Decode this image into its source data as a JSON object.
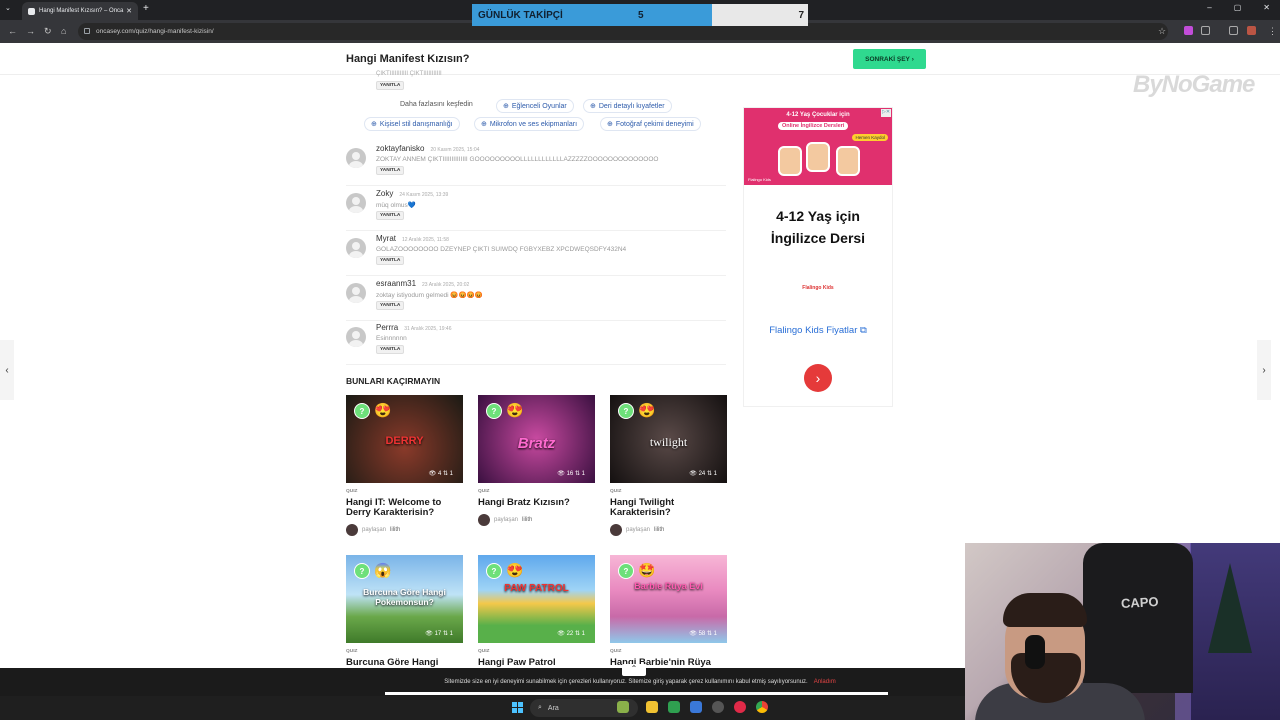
{
  "browser": {
    "tab_title": "Hangi Manifest Kızısın? – Onca",
    "url": "oncasey.com/quiz/hangi-manifest-kizisin/",
    "window_controls": [
      "–",
      "▢",
      "✕"
    ]
  },
  "overlay": {
    "label": "GÜNLÜK TAKİPÇİ",
    "current": "5",
    "goal": "7",
    "progress": 0.714
  },
  "site": {
    "page_title": "Hangi Manifest Kızısın?",
    "next_button": "SONRAKİ ŞEY",
    "watermark": "ByNoGame"
  },
  "comments_top": {
    "truncated_text": "ÇIKTIIIIIIIIIII ÇIKTIIIIIIIIIII",
    "reply": "YANITLA"
  },
  "explore": {
    "label": "Daha fazlasını keşfedin",
    "chips": [
      "Eğlenceli Oyunlar",
      "Deri detaylı kıyafetler",
      "Kişisel stil danışmanlığı",
      "Mikrofon ve ses ekipmanları",
      "Fotoğraf çekimi deneyimi"
    ]
  },
  "comments": [
    {
      "name": "zoktayfanisko",
      "date": "20 Kasım 2025, 15:04",
      "text": "ZOKTAY ANNEM ÇIKTIIIIIIIIIIIIII GOOOOOOOOOLLLLLLLLLLLLAZZZZZOOOOOOOOOOOOOO",
      "reply": "YANITLA"
    },
    {
      "name": "Zoky",
      "date": "24 Kasım 2025, 13:39",
      "text": "müq olmus💙",
      "reply": "YANITLA"
    },
    {
      "name": "Myrat",
      "date": "12 Aralık 2025, 11:58",
      "text": "GOLAZOOOOOOOO DZEYNEP ÇIKTI SUIWDQ FGBYXEBZ XPCDWEQSDFY432N4",
      "reply": "YANITLA"
    },
    {
      "name": "esraanm31",
      "date": "23 Aralık 2025, 20:02",
      "text": "zoktay istiyodum gelmedi 😡😡😡😡",
      "reply": "YANITLA"
    },
    {
      "name": "Perrra",
      "date": "31 Aralık 2025, 19:46",
      "text": "Esinnnnnn",
      "reply": "YANITLA"
    }
  ],
  "section": {
    "title": "BUNLARI KAÇIRMAYIN"
  },
  "cards": [
    {
      "tag": "QUIZ",
      "title": "Hangi IT: Welcome to Derry Karakterisin?",
      "views": "4",
      "shares": "1",
      "thumb_text": "DERRY",
      "emoji": "😍",
      "shared_by": "paylaşan",
      "author": "lilith",
      "bg": "#2a2a22"
    },
    {
      "tag": "QUIZ",
      "title": "Hangi Bratz Kızısın?",
      "views": "16",
      "shares": "1",
      "thumb_text": "Bratz",
      "emoji": "😍",
      "shared_by": "paylaşan",
      "author": "lilith",
      "bg": "#8a2a78"
    },
    {
      "tag": "QUIZ",
      "title": "Hangi Twilight Karakterisin?",
      "views": "24",
      "shares": "1",
      "thumb_text": "twilight",
      "emoji": "😍",
      "shared_by": "paylaşan",
      "author": "lilith",
      "bg": "#3a2e2e"
    },
    {
      "tag": "QUIZ",
      "title": "Burcuna Göre Hangi",
      "views": "17",
      "shares": "1",
      "thumb_text": "Burcuna Göre Hangi Pokemonsun?",
      "emoji": "😱",
      "bg": "#4a8ac8"
    },
    {
      "tag": "QUIZ",
      "title": "Hangi Paw Patrol",
      "views": "22",
      "shares": "1",
      "thumb_text": "PAW PATROL",
      "emoji": "😍",
      "bg": "#58a0e8"
    },
    {
      "tag": "QUIZ",
      "title": "Hangi Barbie'nin Rüya",
      "views": "58",
      "shares": "1",
      "thumb_text": "Barbie Rüya Evi",
      "emoji": "🤩",
      "bg": "#e9a0c8"
    }
  ],
  "ad": {
    "banner_line": "4-12 Yaş Çocuklar için",
    "banner_pill": "Online İngilizce Dersleri",
    "banner_badge": "Hemen Kaydol",
    "banner_brand": "Flalingo Kids",
    "headline_1": "4-12 Yaş için",
    "headline_2": "İngilizce Dersi",
    "logo": "Flalingo Kids",
    "link": "Flalingo Kids Fiyatlar",
    "go": "›"
  },
  "cookie": {
    "text": "Sitemizde size en iyi deneyimi sunabilmek için çerezleri kullanıyoruz. Sitemize giriş yaparak çerez kullanımını kabul etmiş sayılıyorsunuz.",
    "ok": "Anladım"
  },
  "taskbar": {
    "search": "Ara"
  },
  "webcam": {
    "chair_text": "CAPO"
  },
  "colors": {
    "accent_green": "#2fd98f",
    "link_blue": "#2d5bab",
    "overlay_blue": "#3a9bd9"
  }
}
